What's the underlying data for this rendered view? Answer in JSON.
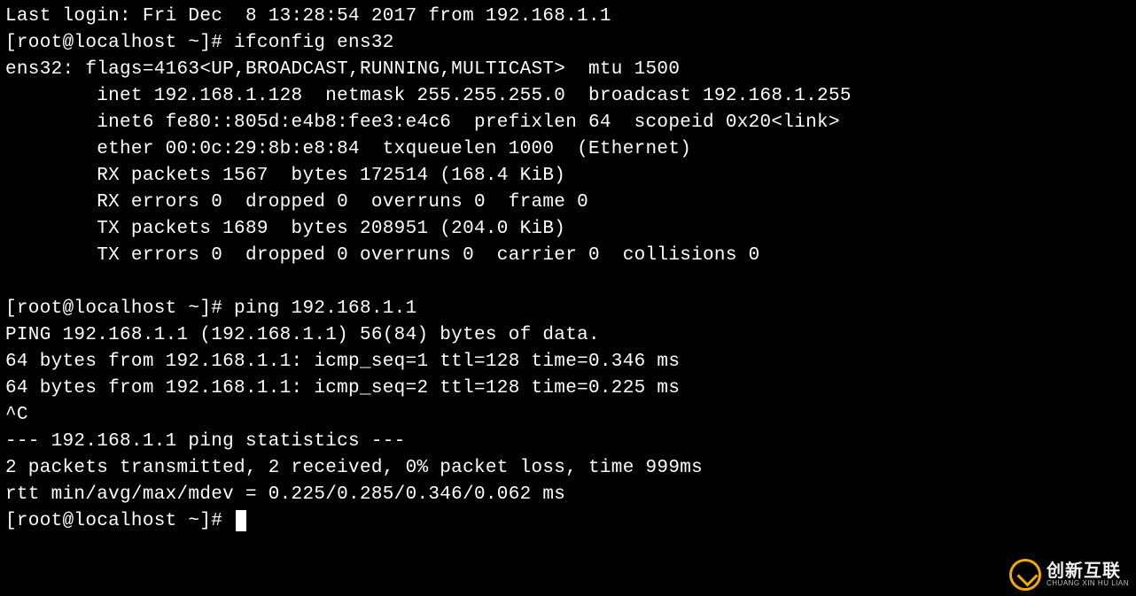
{
  "terminal": {
    "lines": [
      "Last login: Fri Dec  8 13:28:54 2017 from 192.168.1.1",
      "[root@localhost ~]# ifconfig ens32",
      "ens32: flags=4163<UP,BROADCAST,RUNNING,MULTICAST>  mtu 1500",
      "        inet 192.168.1.128  netmask 255.255.255.0  broadcast 192.168.1.255",
      "        inet6 fe80::805d:e4b8:fee3:e4c6  prefixlen 64  scopeid 0x20<link>",
      "        ether 00:0c:29:8b:e8:84  txqueuelen 1000  (Ethernet)",
      "        RX packets 1567  bytes 172514 (168.4 KiB)",
      "        RX errors 0  dropped 0  overruns 0  frame 0",
      "        TX packets 1689  bytes 208951 (204.0 KiB)",
      "        TX errors 0  dropped 0 overruns 0  carrier 0  collisions 0",
      "",
      "[root@localhost ~]# ping 192.168.1.1",
      "PING 192.168.1.1 (192.168.1.1) 56(84) bytes of data.",
      "64 bytes from 192.168.1.1: icmp_seq=1 ttl=128 time=0.346 ms",
      "64 bytes from 192.168.1.1: icmp_seq=2 ttl=128 time=0.225 ms",
      "^C",
      "--- 192.168.1.1 ping statistics ---",
      "2 packets transmitted, 2 received, 0% packet loss, time 999ms",
      "rtt min/avg/max/mdev = 0.225/0.285/0.346/0.062 ms",
      "[root@localhost ~]# "
    ]
  },
  "watermark": {
    "main": "创新互联",
    "sub": "CHUANG XIN HU LIAN"
  }
}
